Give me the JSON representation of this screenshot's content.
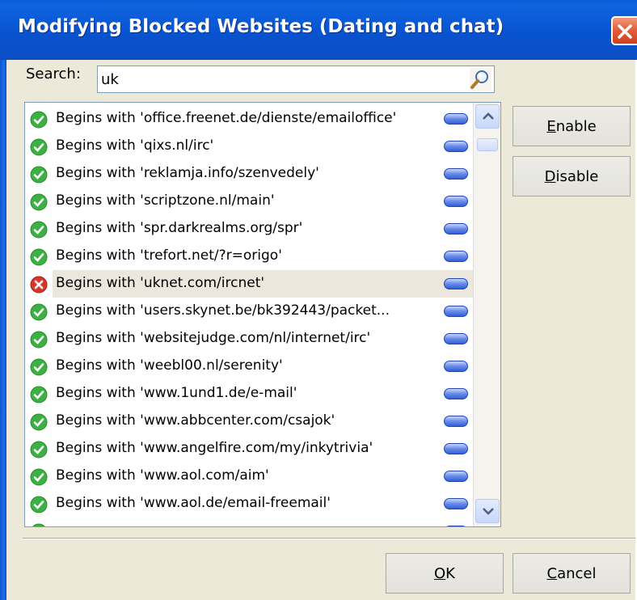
{
  "window": {
    "title": "Modifying Blocked Websites (Dating and chat)"
  },
  "search": {
    "label": "Search:",
    "value": "uk",
    "placeholder": ""
  },
  "list": {
    "rows": [
      {
        "status": "enabled",
        "text": "Begins with 'office.freenet.de/dienste/emailoffice'"
      },
      {
        "status": "enabled",
        "text": "Begins with 'qixs.nl/irc'"
      },
      {
        "status": "enabled",
        "text": "Begins with 'reklamja.info/szenvedely'"
      },
      {
        "status": "enabled",
        "text": "Begins with 'scriptzone.nl/main'"
      },
      {
        "status": "enabled",
        "text": "Begins with 'spr.darkrealms.org/spr'"
      },
      {
        "status": "enabled",
        "text": "Begins with 'trefort.net/?r=origo'"
      },
      {
        "status": "disabled",
        "text": "Begins with 'uknet.com/ircnet'",
        "selected": true
      },
      {
        "status": "enabled",
        "text": "Begins with 'users.skynet.be/bk392443/packet..."
      },
      {
        "status": "enabled",
        "text": "Begins with 'websitejudge.com/nl/internet/irc'"
      },
      {
        "status": "enabled",
        "text": "Begins with 'weebl00.nl/serenity'"
      },
      {
        "status": "enabled",
        "text": "Begins with 'www.1und1.de/e-mail'"
      },
      {
        "status": "enabled",
        "text": "Begins with 'www.abbcenter.com/csajok'"
      },
      {
        "status": "enabled",
        "text": "Begins with 'www.angelfire.com/my/inkytrivia'"
      },
      {
        "status": "enabled",
        "text": "Begins with 'www.aol.com/aim'"
      },
      {
        "status": "enabled",
        "text": "Begins with 'www.aol.de/email-freemail'"
      },
      {
        "status": "enabled",
        "text": ""
      }
    ]
  },
  "buttons": {
    "enable_first": "E",
    "enable_rest": "nable",
    "disable_first": "D",
    "disable_rest": "isable",
    "ok_first": "O",
    "ok_rest": "K",
    "cancel_first": "C",
    "cancel_rest": "ancel"
  },
  "colors": {
    "titlebar": "#0853d0",
    "dialog_bg": "#ece9d8",
    "enabled_icon": "#3cb043",
    "disabled_icon": "#d9362b",
    "selected_row": "#ebe7dc",
    "pill": "#2f5fd9"
  },
  "icons": {
    "close": "close-icon",
    "search": "magnifier-icon",
    "enabled": "check-circle-icon",
    "disabled": "x-circle-icon",
    "scroll_up": "chevron-up-icon",
    "scroll_down": "chevron-down-icon"
  }
}
